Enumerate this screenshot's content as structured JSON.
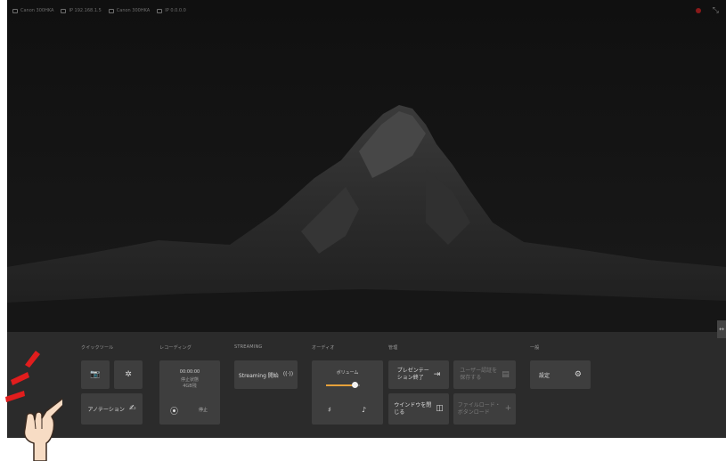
{
  "status_bar": {
    "items": [
      {
        "icon": "camera-icon",
        "text": "Canon 300HKA"
      },
      {
        "icon": "ip-icon",
        "text": "IP 192.168.1.5"
      },
      {
        "icon": "monitor-icon",
        "text": "Canon 300HKA"
      },
      {
        "icon": "ip-icon",
        "text": "IP 0.0.0.0"
      }
    ],
    "recording_indicator_color": "#8a1a1a",
    "expand_icon": "⤡"
  },
  "background": {
    "description_icon": "mountain-wallpaper"
  },
  "side_toggle": {
    "glyph": "↔"
  },
  "toolbar": {
    "background_color": "#2b2b2b",
    "sections": {
      "quick_tools": "クイックツール",
      "recording": "レコーディング",
      "streaming": "STREAMING",
      "audio": "オーディオ",
      "manage": "管理",
      "general": "一般"
    },
    "quick_tools": {
      "camera_glyph": "📷",
      "settings_glyph": "✲",
      "annotation_label": "アノテーション",
      "annotation_glyph": "✍"
    },
    "recording": {
      "time": "00:00:00",
      "state": "停止状態",
      "size": "4GB残",
      "start_glyph": "⦿",
      "stop_label": "停止"
    },
    "streaming": {
      "label": "Streaming 開始",
      "glyph": "((·))"
    },
    "audio": {
      "volume_label": "ボリューム",
      "volume_level": 0.85,
      "mic_glyph": "♯",
      "speaker_glyph": "♪"
    },
    "manage": {
      "end_presentation_label": "プレゼンテー\nション終了",
      "end_presentation_glyph": "⇥",
      "user_hint_label": "ユーザー認証を\n保存する",
      "user_hint_glyph": "▤",
      "close_window_label": "ウインドウを閉\nじる",
      "close_window_glyph": "◫",
      "file_hint_label": "ファイルロード・\nボタンロード",
      "file_hint_glyph": "+"
    },
    "general": {
      "settings_label": "設定",
      "settings_glyph": "⚙"
    }
  },
  "annotation_callout": {
    "accent_color": "#e11d1d",
    "skin_color": "#f7dcc4"
  }
}
